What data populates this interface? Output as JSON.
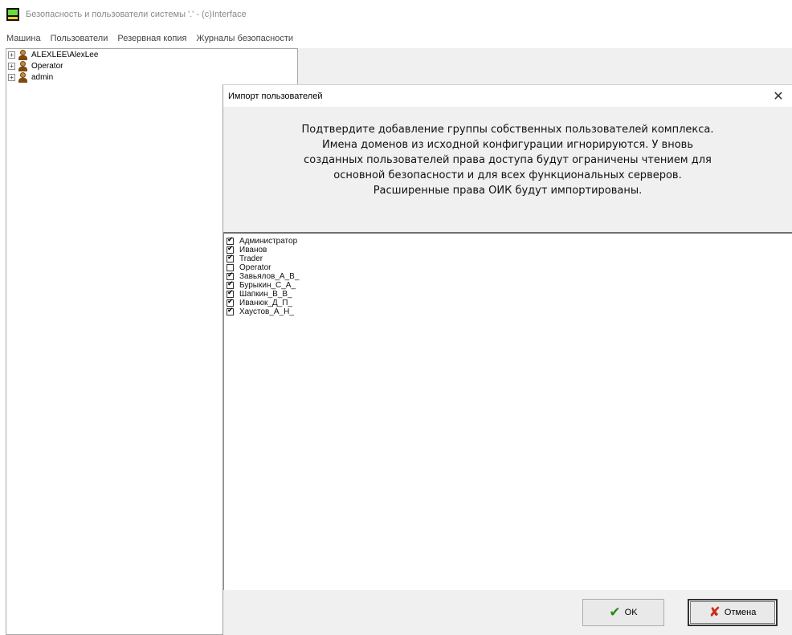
{
  "window": {
    "title": "Безопасность и пользователи системы '.' - (c)Interface"
  },
  "menu": [
    {
      "label": "Машина"
    },
    {
      "label": "Пользователи"
    },
    {
      "label": "Резервная копия"
    },
    {
      "label": "Журналы безопасности"
    }
  ],
  "tree": {
    "nodes": [
      {
        "label": "ALEXLEE\\AlexLee",
        "expander": "+"
      },
      {
        "label": "Operator",
        "expander": "+"
      },
      {
        "label": "admin",
        "expander": "+"
      }
    ]
  },
  "dialog": {
    "title": "Импорт пользователей",
    "close_glyph": "✕",
    "message_lines": [
      "Подтвердите добавление группы собственных пользователей комплекса.",
      "Имена доменов из исходной конфигурации игнорируются. У вновь",
      "созданных пользователей права доступа будут ограничены чтением для",
      "основной безопасности и для всех функциональных серверов.",
      "Расширенные права ОИК будут импортированы."
    ],
    "users": [
      {
        "label": "Администратор",
        "checked": true
      },
      {
        "label": "Иванов",
        "checked": true
      },
      {
        "label": "Trader",
        "checked": true
      },
      {
        "label": "Operator",
        "checked": false
      },
      {
        "label": "Завьялов_А_В_",
        "checked": true
      },
      {
        "label": "Бурыкин_С_А_",
        "checked": true
      },
      {
        "label": "Шапкин_В_В_",
        "checked": true
      },
      {
        "label": "Иванюк_Д_П_",
        "checked": true
      },
      {
        "label": "Хаустов_А_Н_",
        "checked": true
      }
    ],
    "ok_label": "OK",
    "cancel_label": "Отмена",
    "ok_icon": "✔",
    "cancel_icon": "✘"
  },
  "colors": {
    "ok_icon": "#2a8a1a",
    "cancel_icon": "#cc2a1a",
    "dialog_bg": "#f0f0f0"
  }
}
